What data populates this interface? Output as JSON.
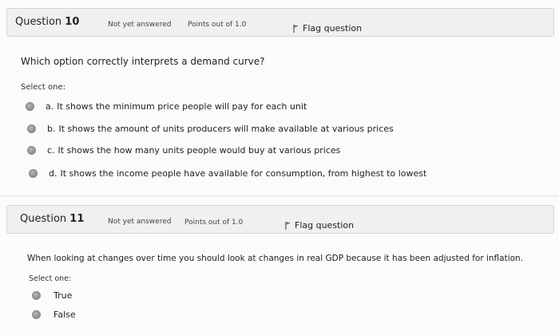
{
  "question10": {
    "label": "Question",
    "number": "10",
    "status": "Not yet answered",
    "points": "Points out of 1.0",
    "flag_label": "Flag question",
    "text": "Which option correctly interprets a demand curve?",
    "select_prompt": "Select one:",
    "options": [
      {
        "letter": "a.",
        "text": "It shows the minimum price people will pay for each unit"
      },
      {
        "letter": "b.",
        "text": "It shows the amount of units producers will make available at various prices"
      },
      {
        "letter": "c.",
        "text": "It shows the how many units people would buy at various prices"
      },
      {
        "letter": "d.",
        "text": "It shows the income people have available for consumption, from highest to lowest"
      }
    ]
  },
  "question11": {
    "label": "Question",
    "number": "11",
    "status": "Not yet answered",
    "points": "Points out of 1.0",
    "flag_label": "Flag question",
    "text": "When looking at changes over time you should look at changes in real GDP because it has been adjusted for inflation.",
    "select_prompt": "Select one:",
    "options": [
      {
        "text": "True"
      },
      {
        "text": "False"
      }
    ]
  },
  "icons": {
    "flag": "flag-icon",
    "radio": "radio-unselected"
  }
}
